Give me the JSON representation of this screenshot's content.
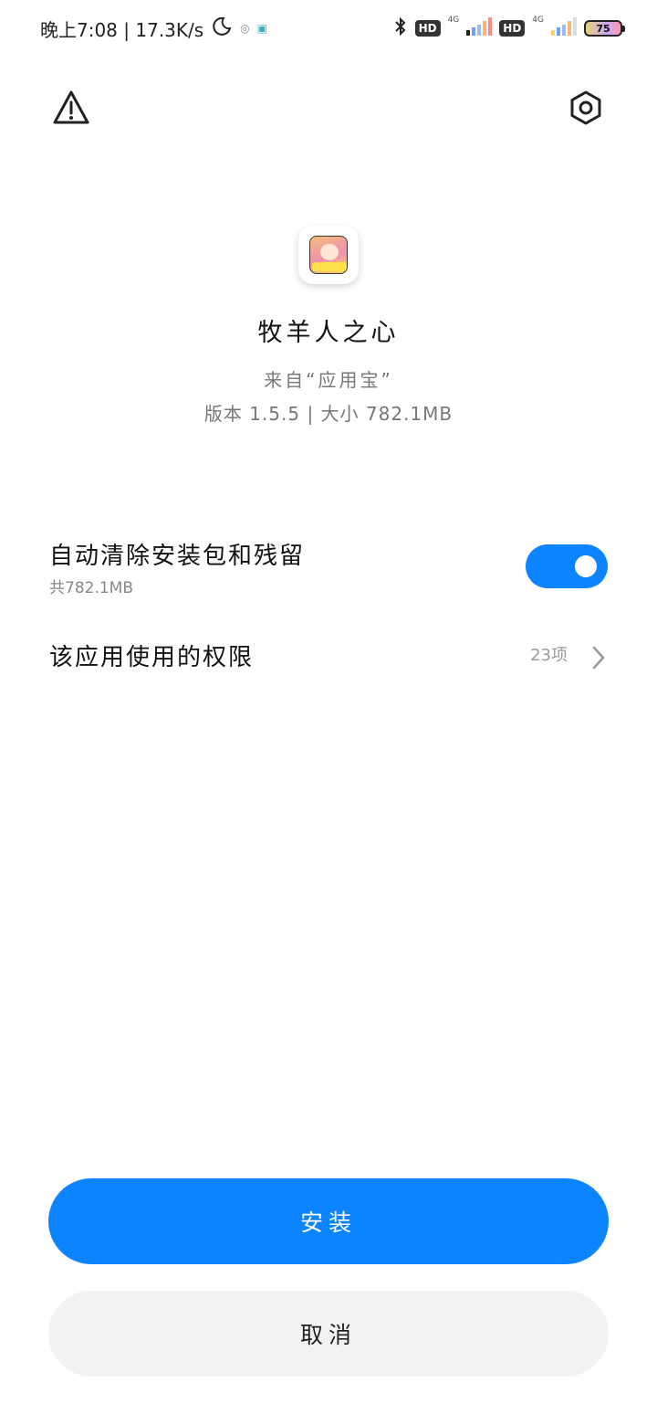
{
  "status_bar": {
    "time_speed": "晚上7:08 | 17.3K/s",
    "net_type_1": "4G",
    "net_type_2": "4G",
    "hd_1": "HD",
    "hd_2": "HD",
    "battery": "75"
  },
  "app": {
    "name": "牧羊人之心",
    "source": "来自“应用宝”",
    "meta": "版本 1.5.5 | 大小 782.1MB"
  },
  "options": {
    "clean": {
      "title": "自动清除安装包和残留",
      "subtitle": "共782.1MB",
      "enabled": true
    },
    "permissions": {
      "title": "该应用使用的权限",
      "count": "23项"
    }
  },
  "actions": {
    "install": "安装",
    "cancel": "取消"
  },
  "colors": {
    "accent": "#0d84ff",
    "cancel_bg": "#f3f3f3"
  }
}
